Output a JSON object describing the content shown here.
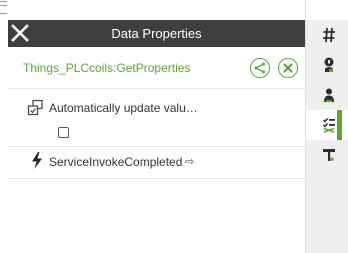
{
  "header": {
    "title": "Data Properties"
  },
  "service": {
    "name": "Things_PLCcoils:GetProperties"
  },
  "auto_update": {
    "label": "Automatically update valu…",
    "checked": false
  },
  "event": {
    "label": "ServiceInvokeCompleted",
    "arrow": "⇨"
  },
  "right_toolbar": {
    "items": [
      {
        "icon": "hash-icon",
        "active": false
      },
      {
        "icon": "user-settings-icon",
        "active": false
      },
      {
        "icon": "user-icon",
        "active": false
      },
      {
        "icon": "list-check-icon",
        "active": true
      },
      {
        "icon": "hammer-icon",
        "active": false
      }
    ]
  },
  "colors": {
    "accent": "#5aa832",
    "header_bg": "#3f3f3f",
    "sidebar_bg": "#efefef"
  }
}
